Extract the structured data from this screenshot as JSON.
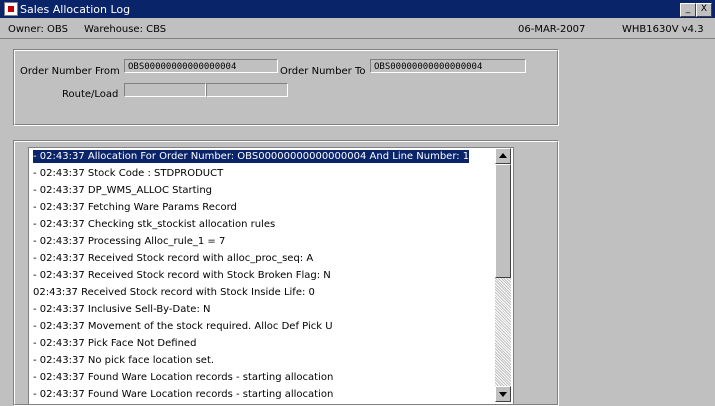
{
  "window": {
    "title": "Sales Allocation Log",
    "minimize_label": "_",
    "close_label": "X"
  },
  "status": {
    "owner": "Owner: OBS",
    "warehouse": "Warehouse: CBS",
    "date": "06-MAR-2007",
    "version": "WHB1630V v4.3"
  },
  "form": {
    "order_from_label": "Order Number From",
    "order_from_value": "OBS00000000000000004",
    "order_to_label": "Order Number To",
    "order_to_value": "OBS00000000000000004",
    "route_label": "Route/Load",
    "route_value": "",
    "load_value": ""
  },
  "log": {
    "items": [
      "- 02:43:37 Allocation For Order Number: OBS00000000000000004 And Line Number: 1",
      "- 02:43:37 Stock Code : STDPRODUCT",
      "- 02:43:37 DP_WMS_ALLOC Starting",
      "- 02:43:37 Fetching Ware Params Record",
      "- 02:43:37 Checking stk_stockist allocation rules",
      "- 02:43:37 Processing Alloc_rule_1 = 7",
      "- 02:43:37 Received Stock record with alloc_proc_seq: A",
      "- 02:43:37 Received Stock record with Stock Broken Flag: N",
      "  02:43:37 Received Stock record with Stock Inside Life: 0",
      "- 02:43:37 Inclusive Sell-By-Date: N",
      "- 02:43:37 Movement of the stock required. Alloc Def Pick U",
      "- 02:43:37 Pick Face Not Defined",
      "- 02:43:37 No pick face location set.",
      "- 02:43:37 Found Ware Location records - starting allocation",
      "- 02:43:37 Found Ware Location records - starting allocation"
    ]
  }
}
